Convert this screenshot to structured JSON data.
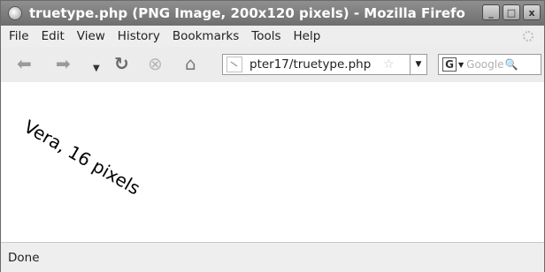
{
  "window": {
    "title": "truetype.php (PNG Image, 200x120 pixels) - Mozilla Firefo",
    "controls": {
      "minimize": "_",
      "maximize": "□",
      "close": "x"
    }
  },
  "menubar": {
    "items": [
      "File",
      "Edit",
      "View",
      "History",
      "Bookmarks",
      "Tools",
      "Help"
    ]
  },
  "navbar": {
    "back_icon": "back-arrow-icon",
    "forward_icon": "forward-arrow-icon",
    "history_drop_icon": "chevron-down-icon",
    "reload_icon": "reload-icon",
    "stop_icon": "stop-icon",
    "home_icon": "home-icon",
    "url": "pter17/truetype.php",
    "search_placeholder": "Google",
    "search_engine": "G"
  },
  "content": {
    "image_text": "Vera, 16 pixels"
  },
  "status": {
    "text": "Done"
  }
}
